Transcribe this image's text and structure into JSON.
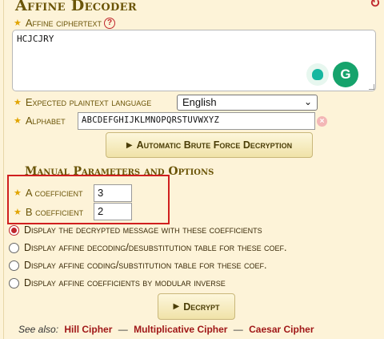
{
  "title": "Affine Decoder",
  "ciphertext": {
    "label": "Affine ciphertext",
    "help": "?",
    "value": "HCJCJRY"
  },
  "language": {
    "label": "Expected plaintext language",
    "selected": "English",
    "chevron": "⌄"
  },
  "alphabet": {
    "label": "Alphabet",
    "value": "ABCDEFGHIJKLMNOPQRSTUVWXYZ",
    "clear": "×"
  },
  "brute_force_button": "Automatic Brute Force Decryption",
  "manual": {
    "title": "Manual Parameters and Options",
    "a_label": "A coefficient",
    "a_value": "3",
    "b_label": "B coefficient",
    "b_value": "2"
  },
  "options": [
    {
      "label": "Display the decrypted message with these coefficients",
      "checked": true
    },
    {
      "label": "Display affine decoding/desubstitution table for these coef.",
      "checked": false
    },
    {
      "label": "Display affine coding/substitution table for these coef.",
      "checked": false
    },
    {
      "label": "Display affine coefficients by modular inverse",
      "checked": false
    }
  ],
  "decrypt_button": "Decrypt",
  "see_also": {
    "label": "See also:",
    "links": [
      "Hill Cipher",
      "Multiplicative Cipher",
      "Caesar Cipher"
    ],
    "separator": "—"
  },
  "icons": {
    "refresh": "refresh-icon",
    "star": "star-icon",
    "help": "help-icon"
  },
  "colors": {
    "accent": "#6b5508",
    "star": "#e1a400",
    "highlight": "#d01f1f",
    "link": "#a01818"
  }
}
